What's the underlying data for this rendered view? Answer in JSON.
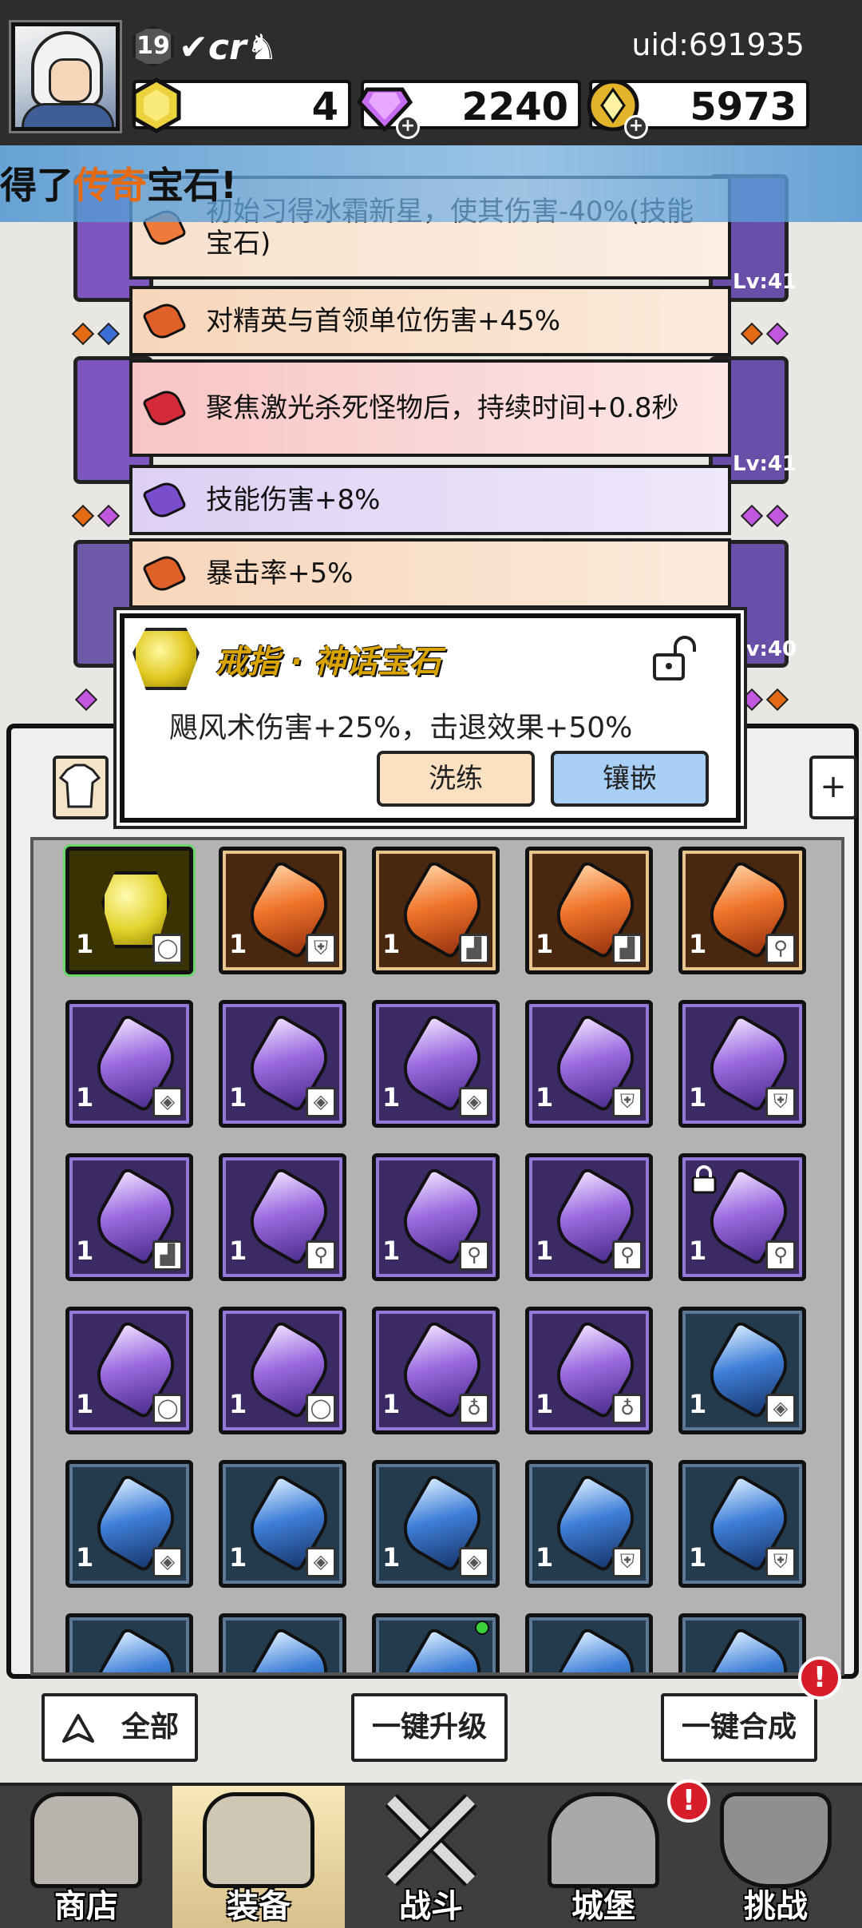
{
  "header": {
    "level": "19",
    "player_name": "✔cr♞",
    "uid": "uid:691935",
    "resources": {
      "gold": "4",
      "gem": "2240",
      "coin": "5973"
    }
  },
  "banner": {
    "prefix": "得了",
    "highlight": "传奇",
    "suffix": "宝石!"
  },
  "background_levels": [
    "Lv:41",
    "Lv:41",
    "Lv:40"
  ],
  "stats": [
    {
      "text": "初始习得冰霜新星，使其伤害-40%(技能宝石)",
      "color": "#f07a3c"
    },
    {
      "text": "对精英与首领单位伤害+45%",
      "color": "#e0602a"
    },
    {
      "text": "聚焦激光杀死怪物后，持续时间+0.8秒",
      "color": "#d42a3a"
    },
    {
      "text": "技能伤害+8%",
      "color": "#7a4dcc"
    },
    {
      "text": "暴击率+5%",
      "color": "#e0602a"
    }
  ],
  "popup": {
    "title": "戒指 · 神话宝石",
    "description": "飓风术伤害+25%，击退效果+50%",
    "reroll_label": "洗练",
    "inlay_label": "镶嵌"
  },
  "bag": {
    "tab_right_label": "+",
    "rows": [
      [
        {
          "quality": "gold",
          "count": "1",
          "slot": "ring-icon",
          "selected": true
        },
        {
          "quality": "orange",
          "count": "1",
          "slot": "armor-icon"
        },
        {
          "quality": "orange",
          "count": "1",
          "slot": "boots-icon"
        },
        {
          "quality": "orange",
          "count": "1",
          "slot": "boots-icon"
        },
        {
          "quality": "orange",
          "count": "1",
          "slot": "weapon-icon"
        }
      ],
      [
        {
          "quality": "purple",
          "count": "1",
          "slot": "shield-icon"
        },
        {
          "quality": "purple",
          "count": "1",
          "slot": "shield-icon"
        },
        {
          "quality": "purple",
          "count": "1",
          "slot": "shield-icon"
        },
        {
          "quality": "purple",
          "count": "1",
          "slot": "armor-icon"
        },
        {
          "quality": "purple",
          "count": "1",
          "slot": "armor-icon"
        }
      ],
      [
        {
          "quality": "purple",
          "count": "1",
          "slot": "boots-icon"
        },
        {
          "quality": "purple",
          "count": "1",
          "slot": "weapon-icon"
        },
        {
          "quality": "purple",
          "count": "1",
          "slot": "weapon-icon"
        },
        {
          "quality": "purple",
          "count": "1",
          "slot": "weapon-icon"
        },
        {
          "quality": "purple",
          "count": "1",
          "slot": "weapon-icon",
          "locked": true
        }
      ],
      [
        {
          "quality": "purple",
          "count": "1",
          "slot": "ring-icon"
        },
        {
          "quality": "purple",
          "count": "1",
          "slot": "ring-icon"
        },
        {
          "quality": "purple",
          "count": "1",
          "slot": "necklace-icon"
        },
        {
          "quality": "purple",
          "count": "1",
          "slot": "necklace-icon"
        },
        {
          "quality": "blue",
          "count": "1",
          "slot": "shield-icon"
        }
      ],
      [
        {
          "quality": "blue",
          "count": "1",
          "slot": "shield-icon"
        },
        {
          "quality": "blue",
          "count": "1",
          "slot": "shield-icon"
        },
        {
          "quality": "blue",
          "count": "1",
          "slot": "shield-icon"
        },
        {
          "quality": "blue",
          "count": "1",
          "slot": "armor-icon"
        },
        {
          "quality": "blue",
          "count": "1",
          "slot": "armor-icon"
        }
      ],
      [
        {
          "quality": "blue",
          "count": "",
          "slot": ""
        },
        {
          "quality": "blue",
          "count": "",
          "slot": ""
        },
        {
          "quality": "blue",
          "count": "",
          "slot": "",
          "new_dot": true
        },
        {
          "quality": "blue",
          "count": "",
          "slot": ""
        },
        {
          "quality": "blue",
          "count": "",
          "slot": ""
        }
      ]
    ]
  },
  "actions": {
    "all_label": "全部",
    "upgrade_label": "一键升级",
    "merge_label": "一键合成",
    "alert_mark": "!"
  },
  "nav": {
    "shop": "商店",
    "equip": "装备",
    "battle": "战斗",
    "castle": "城堡",
    "challenge": "挑战"
  },
  "colors": {
    "accent_gold": "#d9a400",
    "legend_orange": "#e56a14",
    "alert_red": "#d81d2a",
    "inlay_blue": "#a8cff5"
  }
}
